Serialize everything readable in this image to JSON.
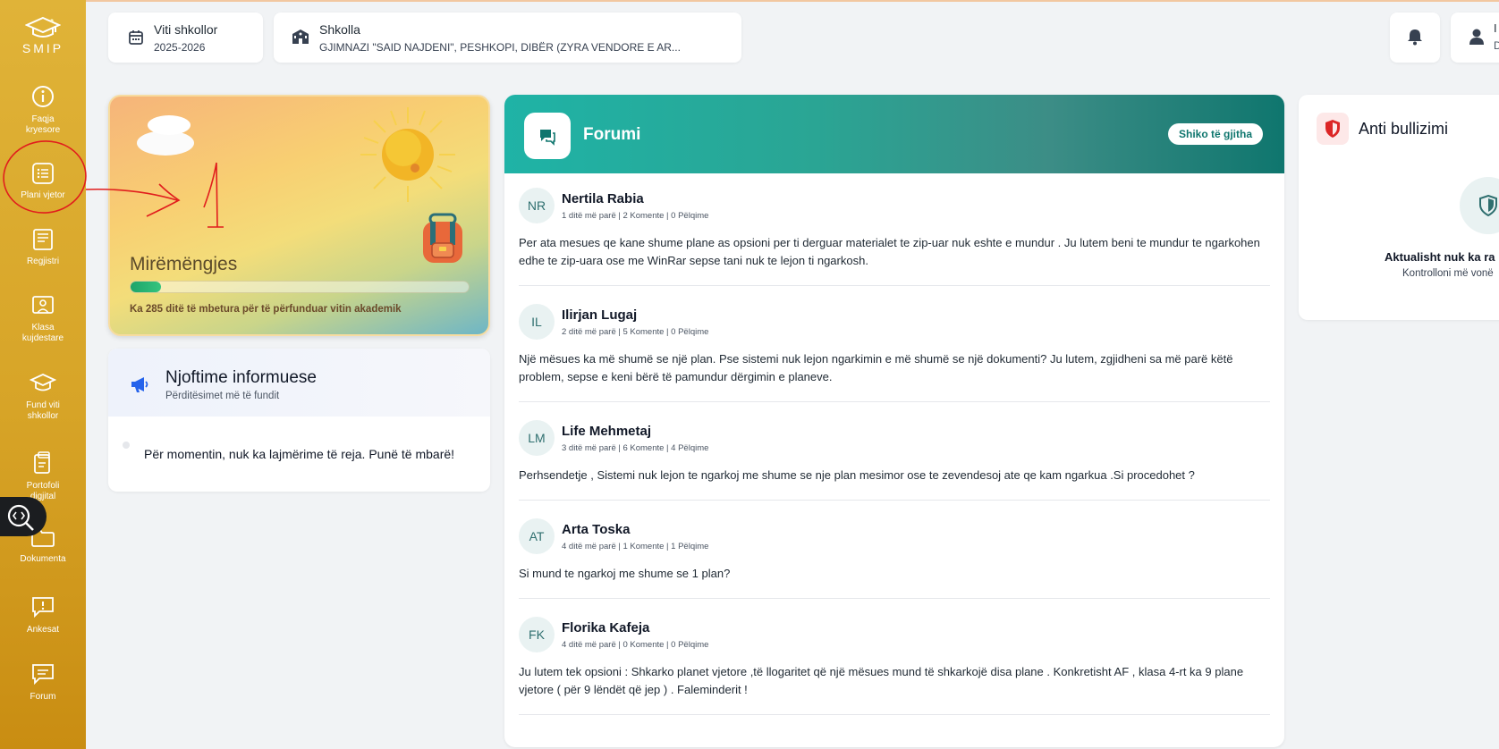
{
  "sidebar": {
    "logo_text": "SMIP",
    "items": [
      {
        "label_line1": "Faqja",
        "label_line2": "kryesore",
        "icon": "info-icon"
      },
      {
        "label_line1": "Plani vjetor",
        "label_line2": "",
        "icon": "list-icon"
      },
      {
        "label_line1": "Regjistri",
        "label_line2": "",
        "icon": "book-icon"
      },
      {
        "label_line1": "Klasa",
        "label_line2": "kujdestare",
        "icon": "classroom-icon"
      },
      {
        "label_line1": "Fund viti",
        "label_line2": "shkollor",
        "icon": "graduation-cap-icon"
      },
      {
        "label_line1": "Portofoli",
        "label_line2": "digjital",
        "icon": "clipboard-icon"
      },
      {
        "label_line1": "Dokumenta",
        "label_line2": "",
        "icon": "folder-icon"
      },
      {
        "label_line1": "Ankesat",
        "label_line2": "",
        "icon": "alert-message-icon"
      },
      {
        "label_line1": "Forum",
        "label_line2": "",
        "icon": "chat-icon"
      }
    ]
  },
  "topbar": {
    "school_year": {
      "title": "Viti shkollor",
      "value": "2025-2026"
    },
    "school": {
      "title": "Shkolla",
      "value": "GJIMNAZI \"SAID NAJDENI\", PESHKOPI, DIBËR (ZYRA VENDORE E AR..."
    },
    "user_initial": "I",
    "user_initial2": "D"
  },
  "welcome": {
    "greeting": "Mirëmëngjes",
    "progress_percent": 9,
    "remaining_text": "Ka 285 ditë të mbetura për të përfunduar vitin akademik"
  },
  "annotation": {
    "text": "1"
  },
  "news": {
    "title": "Njoftime informuese",
    "subtitle": "Përditësimet më të fundit",
    "empty_text": "Për momentin, nuk ka lajmërime të reja. Punë të mbarë!"
  },
  "forum": {
    "title": "Forumi",
    "view_all": "Shiko të gjitha",
    "posts": [
      {
        "initials": "NR",
        "name": "Nertila Rabia",
        "meta": "1 ditë më parë | 2 Komente | 0 Pëlqime",
        "text": "Per ata mesues qe kane shume plane as opsioni per ti derguar materialet te zip-uar nuk eshte e mundur . Ju lutem beni te mundur te ngarkohen edhe te zip-uara ose me WinRar sepse tani nuk te lejon ti ngarkosh."
      },
      {
        "initials": "IL",
        "name": "Ilirjan Lugaj",
        "meta": "2 ditë më parë | 5 Komente | 0 Pëlqime",
        "text": "Një mësues ka më shumë se një plan. Pse sistemi nuk lejon ngarkimin e më shumë se një dokumenti? Ju lutem, zgjidheni sa më parë këtë problem, sepse e keni bërë të pamundur dërgimin e planeve."
      },
      {
        "initials": "LM",
        "name": "Life Mehmetaj",
        "meta": "3 ditë më parë | 6 Komente | 4 Pëlqime",
        "text": "Perhsendetje , Sistemi nuk lejon te ngarkoj me shume se nje plan mesimor ose te zevendesoj ate qe kam ngarkua .Si procedohet ?"
      },
      {
        "initials": "AT",
        "name": "Arta Toska",
        "meta": "4 ditë më parë | 1 Komente | 1 Pëlqime",
        "text": "Si mund te ngarkoj me shume se 1 plan?"
      },
      {
        "initials": "FK",
        "name": "Florika Kafeja",
        "meta": "4 ditë më parë | 0 Komente | 0 Pëlqime",
        "text": "Ju lutem tek opsioni : Shkarko planet vjetore ,të llogaritet që një mësues mund të shkarkojë disa plane . Konkretisht AF , klasa 4-rt ka 9 plane vjetore ( për 9 lëndët që jep ) . Faleminderit !"
      }
    ]
  },
  "anti_bullying": {
    "title": "Anti bullizimi",
    "status": "Aktualisht nuk ka ra",
    "note": "Kontrolloni më vonë"
  },
  "colors": {
    "sidebar": "#d7a427",
    "forum_header": "#1fb3a6",
    "progress": "#1fa46a",
    "accent_red": "#dc2626"
  }
}
